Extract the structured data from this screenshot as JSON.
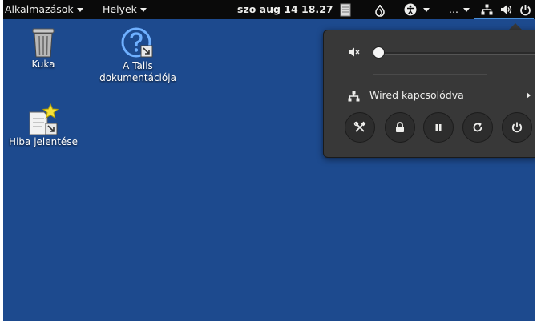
{
  "topbar": {
    "applications_label": "Alkalmazások",
    "places_label": "Helyek",
    "clock": "szo aug 14  18.27",
    "more_label": "...",
    "icons": [
      "clipboard-icon",
      "tor-onion-icon",
      "accessibility-icon",
      "network-icon",
      "volume-icon",
      "power-icon"
    ]
  },
  "desktop": {
    "trash_label": "Kuka",
    "docs_label_line1": "A Tails",
    "docs_label_line2": "dokumentációja",
    "report_label": "Hiba jelentése"
  },
  "menu": {
    "volume_level": 0.03,
    "volume_icon": "volume-muted-icon",
    "network_label": "Wired kapcsolódva",
    "buttons": [
      "settings-button",
      "lock-button",
      "suspend-button",
      "restart-button",
      "power-off-button"
    ]
  },
  "colors": {
    "desktop_bg": "#1d4a8e",
    "topbar_bg": "#0a0a0a",
    "menu_bg": "#383838",
    "accent": "#4a90d9"
  }
}
